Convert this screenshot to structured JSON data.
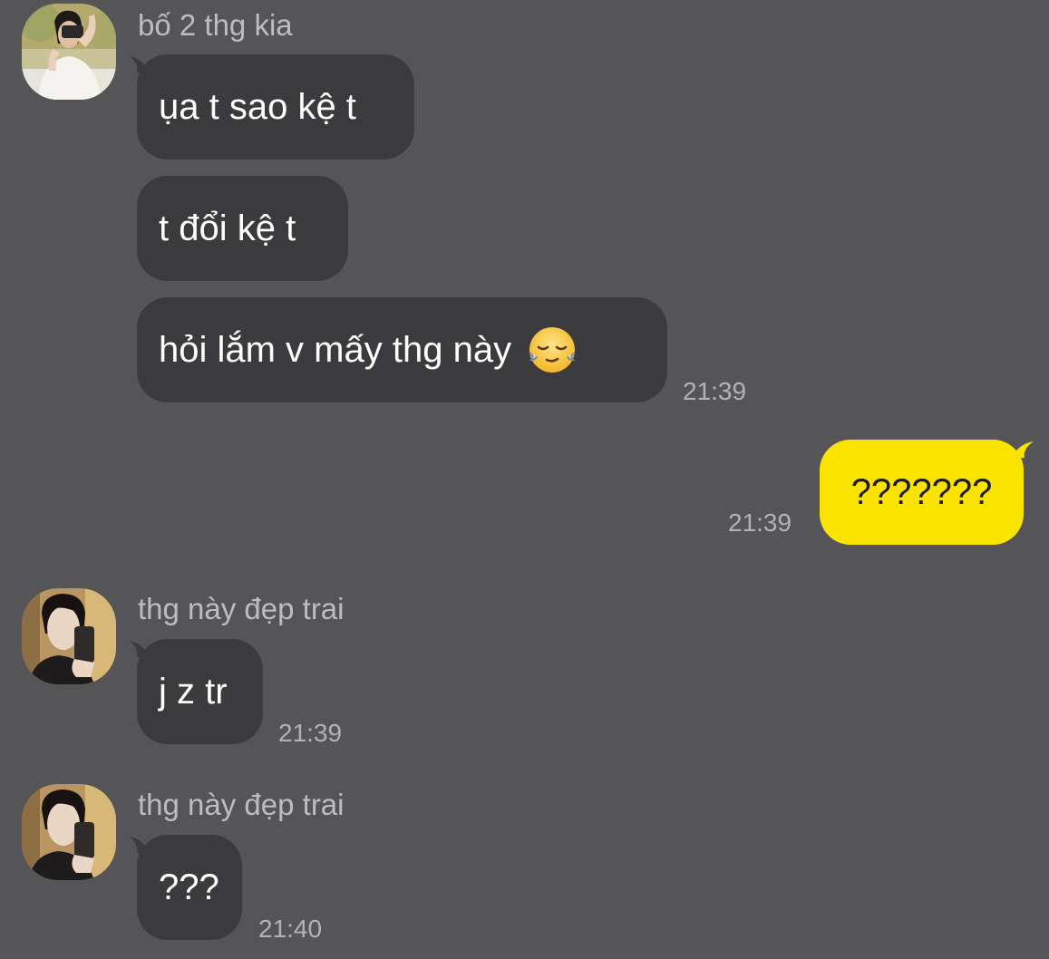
{
  "colors": {
    "background": "#555456",
    "incoming_bubble": "#3b3a3c",
    "outgoing_bubble": "#fbe300",
    "sender_text": "#bdbdbf",
    "timestamp_text": "#b3b3b5"
  },
  "messages": [
    {
      "group": "incoming",
      "sender": "bố 2 thg kia",
      "avatar": "person-with-camera-avatar",
      "bubbles": [
        {
          "text": "ụa t sao kệ t"
        },
        {
          "text": "t đổi kệ t"
        },
        {
          "text": "hỏi lắm v mấy thg này",
          "emoji": "relieved-face-emoji"
        }
      ],
      "time": "21:39"
    },
    {
      "group": "outgoing",
      "bubbles": [
        {
          "text": "???????"
        }
      ],
      "time": "21:39"
    },
    {
      "group": "incoming",
      "sender": "thg này đẹp trai",
      "avatar": "mirror-selfie-avatar",
      "bubbles": [
        {
          "text": "j z tr"
        }
      ],
      "time": "21:39"
    },
    {
      "group": "incoming",
      "sender": "thg này đẹp trai",
      "avatar": "mirror-selfie-avatar",
      "bubbles": [
        {
          "text": "???"
        }
      ],
      "time": "21:40"
    }
  ]
}
